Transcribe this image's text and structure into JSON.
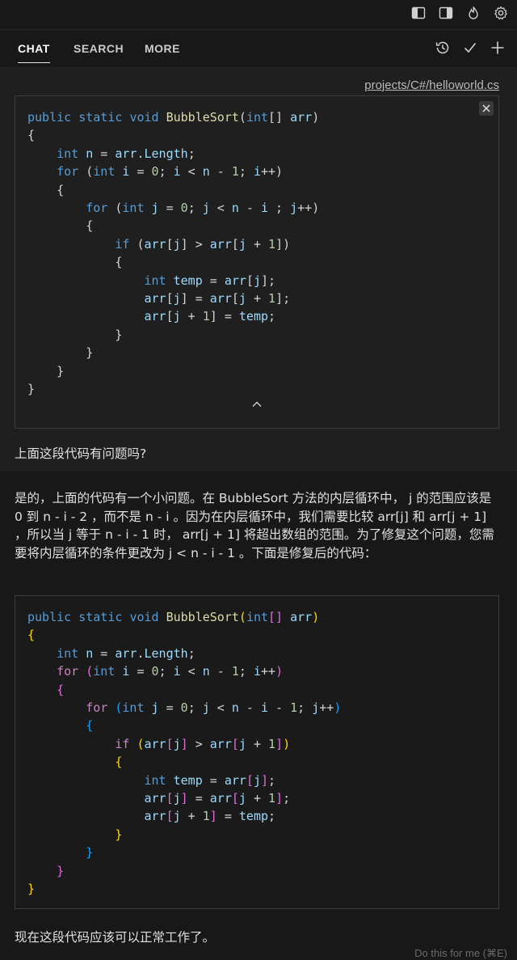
{
  "tabs": [
    {
      "label": "CHAT"
    },
    {
      "label": "SEARCH"
    },
    {
      "label": "MORE"
    }
  ],
  "top_icons": [
    "sidebar-left-icon",
    "sidebar-right-icon",
    "flame-icon",
    "gear-icon"
  ],
  "tab_actions": [
    "history-icon",
    "check-icon",
    "plus-icon"
  ],
  "context": {
    "file_link": "projects/C#/helloworld.cs"
  },
  "code_original": [
    "public static void BubbleSort(int[] arr)",
    "{",
    "    int n = arr.Length;",
    "    for (int i = 0; i < n - 1; i++)",
    "    {",
    "        for (int j = 0; j < n - i ; j++)",
    "        {",
    "            if (arr[j] > arr[j + 1])",
    "            {",
    "                int temp = arr[j];",
    "                arr[j] = arr[j + 1];",
    "                arr[j + 1] = temp;",
    "            }",
    "        }",
    "    }",
    "}"
  ],
  "user_question": "上面这段代码有问题吗?",
  "assistant": {
    "explanation": "是的，上面的代码有一个小问题。在 BubbleSort 方法的内层循环中， j 的范围应该是 0 到 n - i - 2 ，而不是 n - i 。因为在内层循环中，我们需要比较 arr[j] 和 arr[j + 1] ，所以当 j 等于 n - i - 1 时， arr[j + 1] 将超出数组的范围。为了修复这个问题，您需要将内层循环的条件更改为 j < n - i - 1 。下面是修复后的代码：",
    "code_fixed": [
      "public static void BubbleSort(int[] arr)",
      "{",
      "    int n = arr.Length;",
      "    for (int i = 0; i < n - 1; i++)",
      "    {",
      "        for (int j = 0; j < n - i - 1; j++)",
      "        {",
      "            if (arr[j] > arr[j + 1])",
      "            {",
      "                int temp = arr[j];",
      "                arr[j] = arr[j + 1];",
      "                arr[j + 1] = temp;",
      "            }",
      "        }",
      "    }",
      "}"
    ],
    "closing": "现在这段代码应该可以正常工作了。"
  },
  "hint": "Do this for me (⌘E)",
  "colors": {
    "background": "#181818",
    "panel": "#1f1f1f",
    "keyword": "#569cd6",
    "control": "#c586c0",
    "variable": "#9cdcfe",
    "number": "#b5cea8",
    "function": "#dcdcaa",
    "bracket1": "#ffd700",
    "bracket2": "#da70d6",
    "bracket3": "#179fff"
  }
}
